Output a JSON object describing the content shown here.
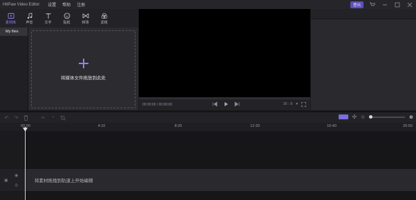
{
  "app_title": "HitPaw Video Editor",
  "menu": [
    "设置",
    "帮助",
    "注册"
  ],
  "header_right": {
    "register_label": "登出"
  },
  "tools": [
    {
      "label": "素材库",
      "icon": "media-icon",
      "active": true
    },
    {
      "label": "声音",
      "icon": "music-icon",
      "active": false
    },
    {
      "label": "文字",
      "icon": "text-icon",
      "active": false
    },
    {
      "label": "贴纸",
      "icon": "sticker-icon",
      "active": false
    },
    {
      "label": "转场",
      "icon": "transition-icon",
      "active": false
    },
    {
      "label": "滤镜",
      "icon": "filter-icon",
      "active": false
    }
  ],
  "sidebar": {
    "items": [
      {
        "label": "My files"
      }
    ]
  },
  "media": {
    "drop_text": "将媒体文件拖放到此处"
  },
  "preview": {
    "time": "00:00:00 / 00:00:00",
    "ratio": "16 : 9",
    "ratio_arrow": "▾"
  },
  "timeline": {
    "ruler": [
      "00:00",
      "4:10",
      "8:20",
      "12:30",
      "16:40",
      "20:50"
    ],
    "hint": "将素材拖拽到轨道上开始编辑"
  },
  "colors": {
    "accent": "#8f82f5",
    "bg": "#1c1c1f"
  }
}
